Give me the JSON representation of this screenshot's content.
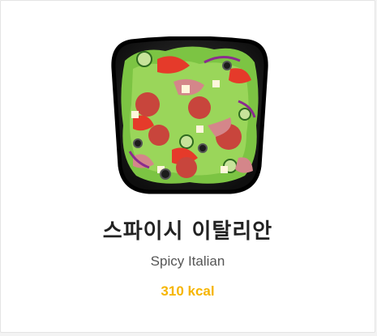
{
  "product": {
    "image_icon": "salad-bowl-image",
    "name_ko": "스파이시 이탈리안",
    "name_en": "Spicy Italian",
    "kcal_label": "310 kcal"
  },
  "colors": {
    "kcal": "#f6b500",
    "title": "#222222",
    "subtitle": "#555555"
  }
}
